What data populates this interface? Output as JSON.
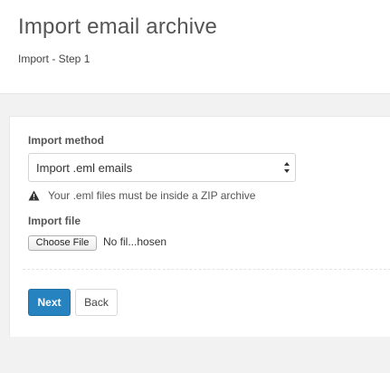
{
  "header": {
    "title": "Import email archive",
    "subtitle": "Import - Step 1"
  },
  "form": {
    "method_label": "Import method",
    "method_selected": "Import .eml emails",
    "hint_icon": "warning-icon",
    "hint_text": "Your .eml files must be inside a ZIP archive",
    "file_label": "Import file",
    "file_button_label": "Choose File",
    "file_status": "No fil...hosen"
  },
  "actions": {
    "next_label": "Next",
    "back_label": "Back"
  },
  "colors": {
    "primary": "#2783bf",
    "page_background": "#f2f2f3"
  }
}
